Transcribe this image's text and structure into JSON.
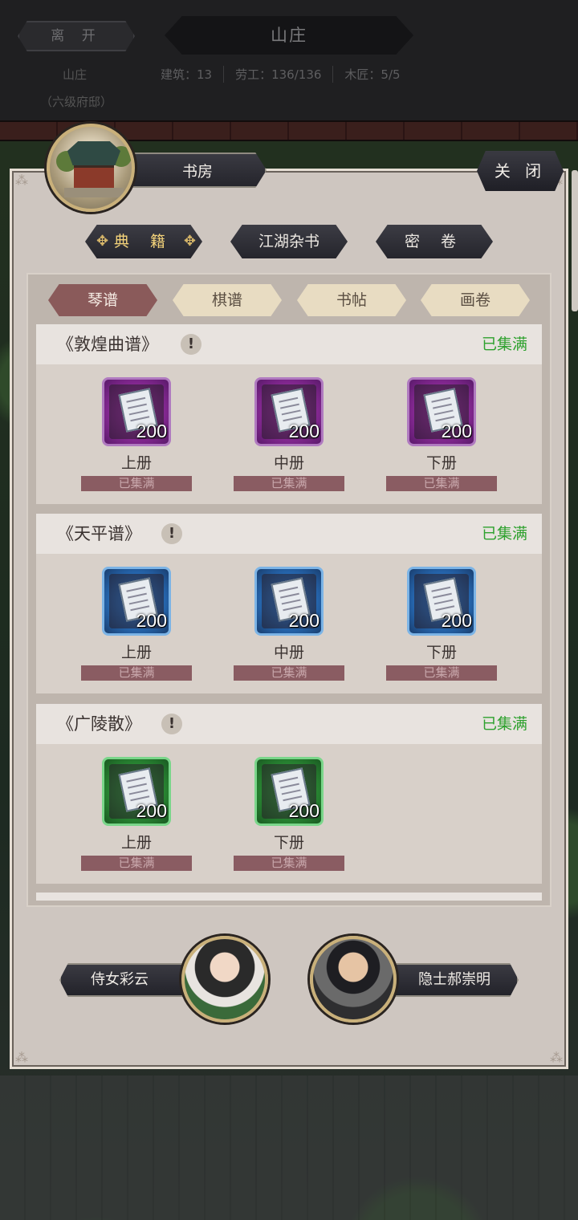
{
  "header": {
    "leave_label": "离 开",
    "title": "山庄",
    "sub_name": "山庄",
    "sub_rank": "（六级府邸）",
    "stats": [
      "建筑：13",
      "劳工：136/136",
      "木匠：5/5"
    ]
  },
  "panel": {
    "room_name": "书房",
    "close_label": "关 闭",
    "categories": [
      "典 籍",
      "江湖杂书",
      "密 卷"
    ],
    "subtabs": [
      "琴谱",
      "棋谱",
      "书帖",
      "画卷"
    ]
  },
  "sections": [
    {
      "title": "《敦煌曲谱》",
      "status": "已集满",
      "color": "purple",
      "items": [
        {
          "qty": "200",
          "name": "上册",
          "status": "已集满"
        },
        {
          "qty": "200",
          "name": "中册",
          "status": "已集满"
        },
        {
          "qty": "200",
          "name": "下册",
          "status": "已集满"
        }
      ]
    },
    {
      "title": "《天平谱》",
      "status": "已集满",
      "color": "blue",
      "items": [
        {
          "qty": "200",
          "name": "上册",
          "status": "已集满"
        },
        {
          "qty": "200",
          "name": "中册",
          "status": "已集满"
        },
        {
          "qty": "200",
          "name": "下册",
          "status": "已集满"
        }
      ]
    },
    {
      "title": "《广陵散》",
      "status": "已集满",
      "color": "green",
      "items": [
        {
          "qty": "200",
          "name": "上册",
          "status": "已集满"
        },
        {
          "qty": "200",
          "name": "下册",
          "status": "已集满"
        }
      ]
    }
  ],
  "npcs": {
    "left_name": "侍女彩云",
    "right_name": "隐士郝崇明"
  },
  "colors": {
    "status_green": "#2ea12e",
    "active_subtab": "#8a5a5a",
    "active_category_text": "#f3d27a"
  }
}
